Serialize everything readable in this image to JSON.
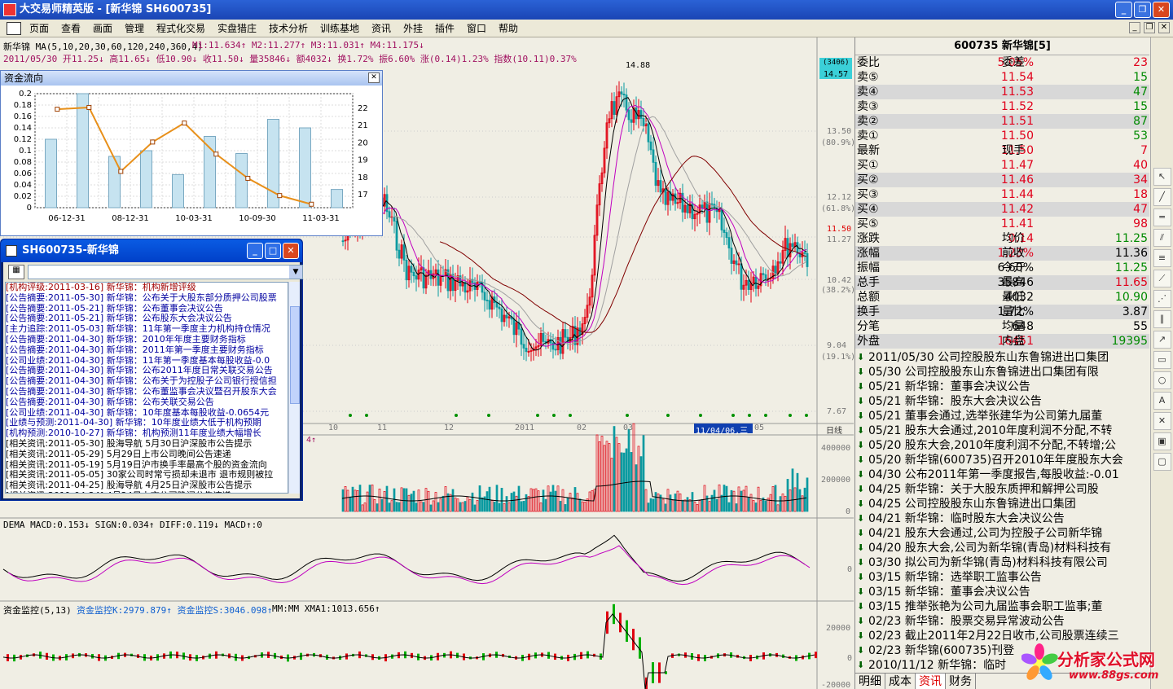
{
  "window": {
    "title": "大交易师精英版  - [新华锦  SH600735]",
    "buttons": {
      "minimize": "_",
      "restore": "❐",
      "close": "✕"
    }
  },
  "menu": {
    "items": [
      "页面",
      "查看",
      "画面",
      "管理",
      "程式化交易",
      "实盘猎庄",
      "技术分析",
      "训练基地",
      "资讯",
      "外挂",
      "插件",
      "窗口",
      "帮助"
    ]
  },
  "chart": {
    "ma_line": "新华锦  MA(5,10,20,30,60,120,240,360,4)",
    "ma_values": "M1:11.634↑  M2:11.277↑  M3:11.031↑  M4:11.175↓",
    "bar_info": "2011/05/30  开11.25↓ 高11.65↓ 低10.90↓ 收11.50↓ 量35846↓ 额4032↓ 换1.72% 振6.60% 涨(0.14)1.23%  指数(10.11)0.37%",
    "price_high_label": "14.88",
    "price_ticks": [
      "13.50",
      "12.12",
      "11.50",
      "11.27",
      "10.42",
      "9.04",
      "7.67"
    ],
    "pct_ticks": [
      "(80.9%)",
      "(61.8%)",
      "(38.2%)",
      "(19.1%)"
    ],
    "top_tag": "(3406)",
    "top_price": "14.57",
    "x_ticks": [
      "10",
      "11",
      "12",
      "2011",
      "02",
      "03",
      "05"
    ],
    "cursor_date": "11/04/06,三",
    "period_label": "日线",
    "vol_ticks": [
      "400000",
      "200000",
      "0"
    ],
    "vol_header_tail": "4↑",
    "macd_header": "DEMA MACD:0.153↓ SIGN:0.034↑ DIFF:0.119↓ MACD↑:0",
    "macd_tick": "0",
    "fund_header_a": "资金监控(5,13)",
    "fund_header_b": "资金监控K:2979.879↑ 资金监控S:3046.098↑",
    "fund_header_c": "MM:MM XMA1:1013.656↑",
    "fund_ticks": [
      "20000",
      "0",
      "-20000"
    ]
  },
  "flow_window": {
    "title": "资金流向",
    "close": "✕",
    "y_left": [
      "0.2",
      "0.18",
      "0.16",
      "0.14",
      "0.12",
      "0.1",
      "0.08",
      "0.06",
      "0.04",
      "0.02",
      "0"
    ],
    "y_right": [
      "22",
      "21",
      "20",
      "19",
      "18",
      "17"
    ],
    "x_labels": [
      "06-12-31",
      "08-12-31",
      "10-03-31",
      "10-09-30",
      "11-03-31"
    ],
    "chart_data": {
      "type": "bar",
      "bar_values": [
        0.12,
        0.2,
        0.09,
        0.1,
        0.058,
        0.125,
        0.095,
        0.155,
        0.14,
        0.032
      ],
      "line_values": [
        21.9,
        22.0,
        18.3,
        20.0,
        21.1,
        19.3,
        17.9,
        16.9,
        16.4,
        null
      ],
      "ylim_left": [
        0,
        0.2
      ],
      "ylim_right": [
        16.2,
        22.8
      ]
    }
  },
  "info_window": {
    "title": "SH600735-新华锦",
    "items": [
      {
        "tag": "[机构评级:2011-03-16]",
        "text": "新华锦：机构新增评级"
      },
      {
        "tag": "[公告摘要:2011-05-30]",
        "text": "新华锦：公布关于大股东部分质押公司股票"
      },
      {
        "tag": "[公告摘要:2011-05-21]",
        "text": "新华锦：公布董事会决议公告"
      },
      {
        "tag": "[公告摘要:2011-05-21]",
        "text": "新华锦：公布股东大会决议公告"
      },
      {
        "tag": "[主力追踪:2011-05-03]",
        "text": "新华锦：11年第一季度主力机构持仓情况"
      },
      {
        "tag": "[公告摘要:2011-04-30]",
        "text": "新华锦：2010年年度主要财务指标"
      },
      {
        "tag": "[公告摘要:2011-04-30]",
        "text": "新华锦：2011年第一季度主要财务指标"
      },
      {
        "tag": "[公司业绩:2011-04-30]",
        "text": "新华锦：11年第一季度基本每股收益-0.0"
      },
      {
        "tag": "[公告摘要:2011-04-30]",
        "text": "新华锦：公布2011年度日常关联交易公告"
      },
      {
        "tag": "[公告摘要:2011-04-30]",
        "text": "新华锦：公布关于为控股子公司银行授信担"
      },
      {
        "tag": "[公告摘要:2011-04-30]",
        "text": "新华锦：公布董监事会决议暨召开股东大会"
      },
      {
        "tag": "[公告摘要:2011-04-30]",
        "text": "新华锦：公布关联交易公告"
      },
      {
        "tag": "[公司业绩:2011-04-30]",
        "text": "新华锦：10年度基本每股收益-0.0654元"
      },
      {
        "tag": "[业绩与预测:2011-04-30]",
        "text": "新华锦：10年度业绩大低于机构预期"
      },
      {
        "tag": "[机构预测:2010-10-27]",
        "text": "新华锦：机构预测11年度业绩大幅增长"
      },
      {
        "tag": "[相关资讯:2011-05-30]",
        "text": "股海导航 5月30日沪深股市公告提示"
      },
      {
        "tag": "[相关资讯:2011-05-29]",
        "text": "5月29日上市公司晚间公告速递"
      },
      {
        "tag": "[相关资讯:2011-05-19]",
        "text": "5月19日沪市换手率最高个股的资金流向"
      },
      {
        "tag": "[相关资讯:2011-05-05]",
        "text": "30家公司时常亏损却未退市 退市规则被拉"
      },
      {
        "tag": "[相关资讯:2011-04-25]",
        "text": "股海导航 4月25日沪深股市公告提示"
      },
      {
        "tag": "[相关资讯:2011-04-24]",
        "text": "4月24日上市公司晚间公告速递"
      }
    ]
  },
  "quote": {
    "title": "600735 新华锦[5]",
    "rows": [
      {
        "l": "委比",
        "v": "5.05%",
        "vc": "red",
        "l2": "委差",
        "v2": "23",
        "v2c": "red",
        "alt": false
      },
      {
        "l": "卖⑤",
        "v": "11.54",
        "vc": "red",
        "l2": "",
        "v2": "15",
        "v2c": "green",
        "alt": false
      },
      {
        "l": "卖④",
        "v": "11.53",
        "vc": "red",
        "l2": "",
        "v2": "47",
        "v2c": "green",
        "alt": true
      },
      {
        "l": "卖③",
        "v": "11.52",
        "vc": "red",
        "l2": "",
        "v2": "15",
        "v2c": "green",
        "alt": false
      },
      {
        "l": "卖②",
        "v": "11.51",
        "vc": "red",
        "l2": "",
        "v2": "87",
        "v2c": "green",
        "alt": true
      },
      {
        "l": "卖①",
        "v": "11.50",
        "vc": "red",
        "l2": "",
        "v2": "53",
        "v2c": "green",
        "alt": false
      },
      {
        "l": "最新",
        "v": "11.50",
        "vc": "red",
        "l2": "现手",
        "v2": "7",
        "v2c": "red",
        "alt": false
      },
      {
        "l": "买①",
        "v": "11.47",
        "vc": "red",
        "l2": "",
        "v2": "40",
        "v2c": "red",
        "alt": false
      },
      {
        "l": "买②",
        "v": "11.46",
        "vc": "red",
        "l2": "",
        "v2": "34",
        "v2c": "red",
        "alt": true
      },
      {
        "l": "买③",
        "v": "11.44",
        "vc": "red",
        "l2": "",
        "v2": "18",
        "v2c": "red",
        "alt": false
      },
      {
        "l": "买④",
        "v": "11.42",
        "vc": "red",
        "l2": "",
        "v2": "47",
        "v2c": "red",
        "alt": true
      },
      {
        "l": "买⑤",
        "v": "11.41",
        "vc": "red",
        "l2": "",
        "v2": "98",
        "v2c": "red",
        "alt": false
      },
      {
        "l": "涨跌",
        "v": "0.14",
        "vc": "red",
        "l2": "均价",
        "v2": "11.25",
        "v2c": "green",
        "alt": false
      },
      {
        "l": "涨幅",
        "v": "1.23%",
        "vc": "red",
        "l2": "前收",
        "v2": "11.36",
        "v2c": "blk",
        "alt": true
      },
      {
        "l": "振幅",
        "v": "6.60%",
        "vc": "blk",
        "l2": "今开",
        "v2": "11.25",
        "v2c": "green",
        "alt": false
      },
      {
        "l": "总手",
        "v": "35846",
        "vc": "blk",
        "l2": "最高",
        "v2": "11.65",
        "v2c": "red",
        "alt": true
      },
      {
        "l": "总额",
        "v": "4032",
        "vc": "blk",
        "l2": "最低",
        "v2": "10.90",
        "v2c": "green",
        "alt": false
      },
      {
        "l": "换手",
        "v": "1.72%",
        "vc": "blk",
        "l2": "量比",
        "v2": "3.87",
        "v2c": "blk",
        "alt": true
      },
      {
        "l": "分笔",
        "v": "648",
        "vc": "blk",
        "l2": "均量",
        "v2": "55",
        "v2c": "blk",
        "alt": false
      },
      {
        "l": "外盘",
        "v": "16451",
        "vc": "red",
        "l2": "内盘",
        "v2": "19395",
        "v2c": "green",
        "alt": true
      }
    ]
  },
  "news": [
    "2011/05/30 公司控股股东山东鲁锦进出口集团",
    "05/30 公司控股股东山东鲁锦进出口集团有限",
    "05/21 新华锦：董事会决议公告",
    "05/21 新华锦：股东大会决议公告",
    "05/21 董事会通过,选举张建华为公司第九届董",
    "05/21 股东大会通过,2010年度利润不分配,不转",
    "05/20 股东大会,2010年度利润不分配,不转增;公",
    "05/20 新华锦(600735)召开2010年年度股东大会",
    "04/30 公布2011年第一季度报告,每股收益:-0.01",
    "04/25 新华锦：关于大股东质押和解押公司股",
    "04/25 公司控股股东山东鲁锦进出口集团",
    "04/21 新华锦：临时股东大会决议公告",
    "04/21 股东大会通过,公司为控股子公司新华锦",
    "04/20 股东大会,公司为新华锦(青岛)材料科技有",
    "03/30 拟公司为新华锦(青岛)材料科技有限公司",
    "03/15 新华锦：选举职工监事公告",
    "03/15 新华锦：董事会决议公告",
    "03/15 推举张艳为公司九届监事会职工监事;董",
    "02/23 新华锦：股票交易异常波动公告",
    "02/23 截止2011年2月22日收市,公司股票连续三",
    "02/23 新华锦(600735)刊登",
    "2010/11/12 新华锦：临时"
  ],
  "tabs": [
    "明细",
    "成本",
    "资讯",
    "财务"
  ],
  "active_tab": 2,
  "logo": {
    "text": "分析家公式网",
    "url": "www.88gs.com"
  }
}
